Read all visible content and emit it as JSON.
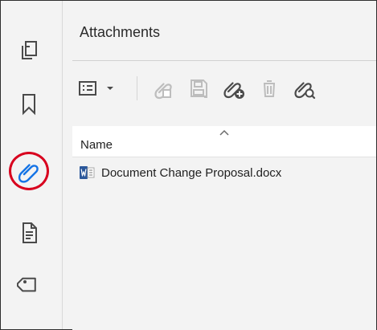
{
  "panel": {
    "title": "Attachments",
    "column_header": "Name"
  },
  "attachments": [
    {
      "file_name": "Document Change Proposal.docx",
      "file_icon": "word-document-icon"
    }
  ],
  "left_rail": {
    "items": [
      {
        "icon": "pages-icon"
      },
      {
        "icon": "bookmark-icon"
      },
      {
        "icon": "attachment-icon",
        "active": true
      },
      {
        "icon": "document-properties-icon"
      },
      {
        "icon": "tag-icon"
      }
    ]
  },
  "toolbar": {
    "items": [
      {
        "icon": "view-options-icon"
      },
      {
        "icon": "dropdown-arrow-icon"
      },
      {
        "icon": "open-attachment-icon"
      },
      {
        "icon": "save-attachment-icon"
      },
      {
        "icon": "add-attachment-icon"
      },
      {
        "icon": "delete-attachment-icon"
      },
      {
        "icon": "search-attachment-icon"
      }
    ]
  },
  "colors": {
    "panel_background": "#f3f3f3",
    "accent_blue": "#1473e6",
    "highlight_red": "#d8001e",
    "icon_gray": "#4a4a4a",
    "disabled_gray": "#bdbdbd",
    "word_blue": "#2b579a"
  }
}
